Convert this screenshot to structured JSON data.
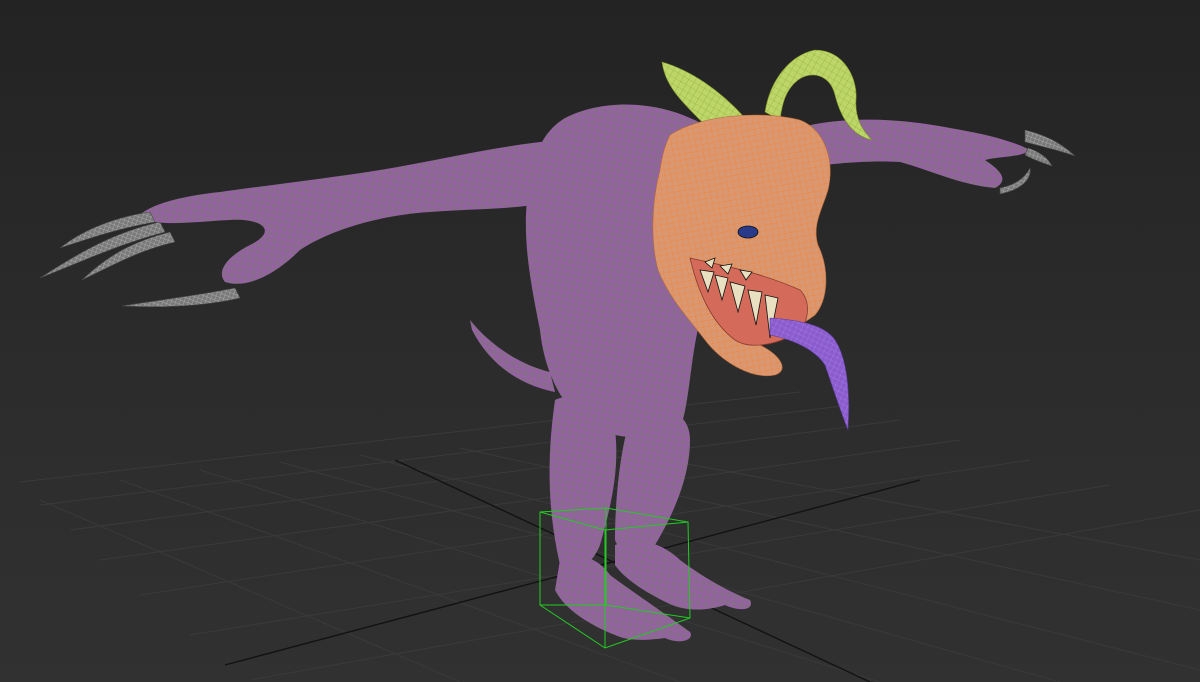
{
  "viewport": {
    "background": "#2b2b2b",
    "grid_color": "#3c3c3c",
    "axis_color": "#111111"
  },
  "model": {
    "body_color": "#8a6a8f",
    "body_wire_color": "#c040f0",
    "head_color": "#d99872",
    "head_wire_color": "#ff7a1e",
    "horn_color": "#bcd66a",
    "horn_wire_color": "#8da62a",
    "claw_color": "#8a8a8a",
    "tongue_color": "#8a5ccc",
    "teeth_color": "#e8e0c0",
    "mouth_color": "#d46b5a"
  },
  "selection": {
    "gizmo_color": "#22cc22"
  }
}
